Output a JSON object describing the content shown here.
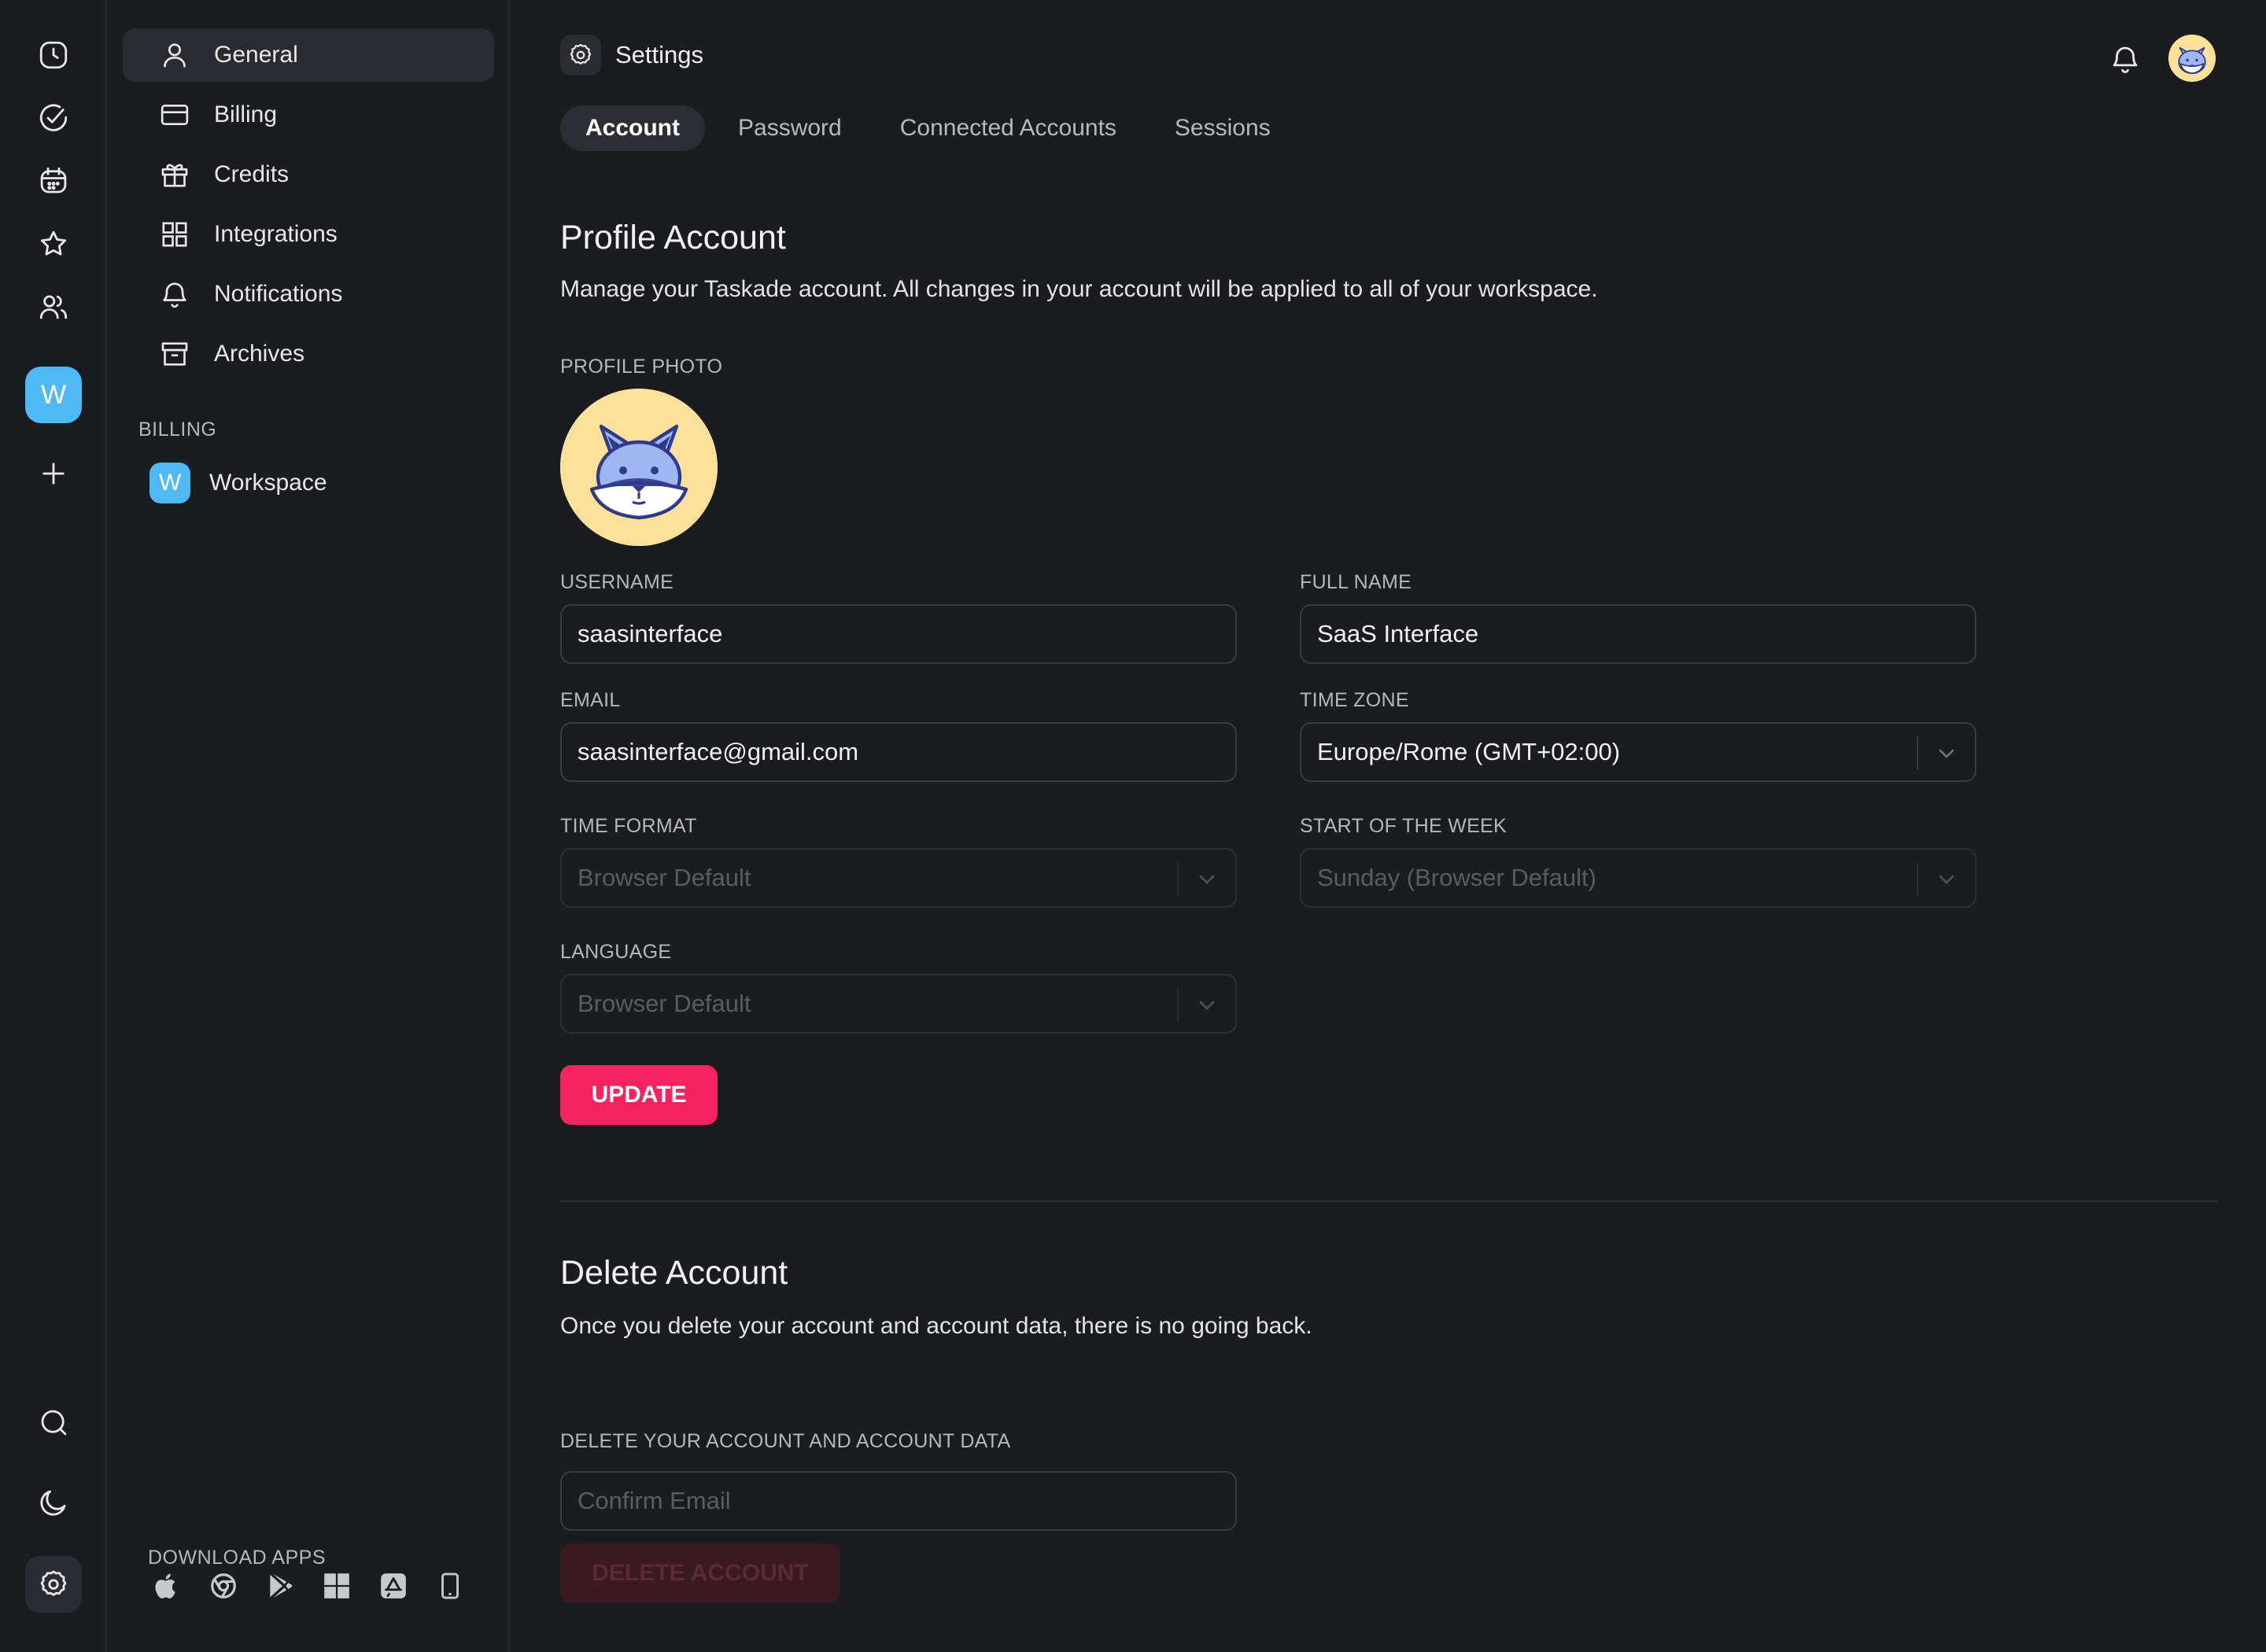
{
  "rail": {
    "items": [
      {
        "icon": "clock-icon"
      },
      {
        "icon": "check-circle-icon"
      },
      {
        "icon": "calendar-icon"
      },
      {
        "icon": "star-icon"
      },
      {
        "icon": "users-icon"
      }
    ],
    "workspace_initial": "W",
    "bottom": [
      {
        "icon": "search-icon"
      },
      {
        "icon": "moon-icon"
      },
      {
        "icon": "gear-icon"
      }
    ]
  },
  "sidebar": {
    "items": [
      {
        "label": "General",
        "icon": "user-icon",
        "active": true
      },
      {
        "label": "Billing",
        "icon": "credit-card-icon"
      },
      {
        "label": "Credits",
        "icon": "gift-icon"
      },
      {
        "label": "Integrations",
        "icon": "grid-icon"
      },
      {
        "label": "Notifications",
        "icon": "bell-icon"
      },
      {
        "label": "Archives",
        "icon": "archive-icon"
      }
    ],
    "billing_section": "BILLING",
    "workspace": {
      "initial": "W",
      "label": "Workspace"
    },
    "download_section": "DOWNLOAD APPS",
    "apps": [
      "apple-icon",
      "chrome-icon",
      "google-play-icon",
      "windows-icon",
      "app-store-icon",
      "mobile-icon"
    ]
  },
  "header": {
    "title": "Settings"
  },
  "tabs": [
    {
      "label": "Account",
      "active": true
    },
    {
      "label": "Password"
    },
    {
      "label": "Connected Accounts"
    },
    {
      "label": "Sessions"
    }
  ],
  "profile": {
    "title": "Profile Account",
    "description": "Manage your Taskade account. All changes in your account will be applied to all of your workspace.",
    "photo_label": "PROFILE PHOTO",
    "username_label": "USERNAME",
    "username": "saasinterface",
    "fullname_label": "FULL NAME",
    "fullname": "SaaS Interface",
    "email_label": "EMAIL",
    "email": "saasinterface@gmail.com",
    "timezone_label": "TIME ZONE",
    "timezone": "Europe/Rome (GMT+02:00)",
    "timeformat_label": "TIME FORMAT",
    "timeformat": "Browser Default",
    "weekstart_label": "START OF THE WEEK",
    "weekstart": "Sunday (Browser Default)",
    "language_label": "LANGUAGE",
    "language": "Browser Default",
    "update_label": "UPDATE",
    "accent": "#f5235f"
  },
  "delete": {
    "title": "Delete Account",
    "description": "Once you delete your account and account data, there is no going back.",
    "confirm_label": "DELETE YOUR ACCOUNT AND ACCOUNT DATA",
    "confirm_placeholder": "Confirm Email",
    "button_label": "DELETE ACCOUNT"
  }
}
